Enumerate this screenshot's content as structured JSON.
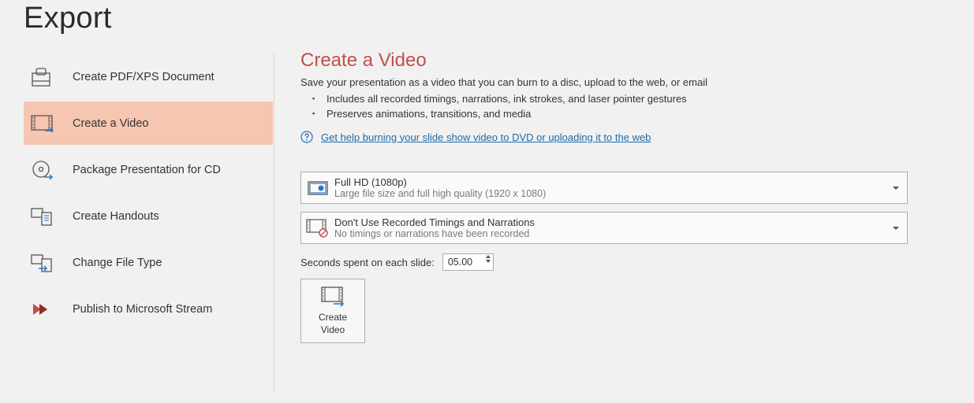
{
  "page_title": "Export",
  "sidebar": {
    "items": [
      {
        "label": "Create PDF/XPS Document"
      },
      {
        "label": "Create a Video"
      },
      {
        "label": "Package Presentation for CD"
      },
      {
        "label": "Create Handouts"
      },
      {
        "label": "Change File Type"
      },
      {
        "label": "Publish to Microsoft Stream"
      }
    ],
    "selected_index": 1
  },
  "panel": {
    "title": "Create a Video",
    "subtitle": "Save your presentation as a video that you can burn to a disc, upload to the web, or email",
    "bullet1": "Includes all recorded timings, narrations, ink strokes, and laser pointer gestures",
    "bullet2": "Preserves animations, transitions, and media",
    "help_link": "Get help burning your slide show video to DVD or uploading it to the web"
  },
  "quality": {
    "title": "Full HD (1080p)",
    "sub": "Large file size and full high quality (1920 x 1080)"
  },
  "timings": {
    "title": "Don't Use Recorded Timings and Narrations",
    "sub": "No timings or narrations have been recorded"
  },
  "seconds": {
    "label": "Seconds spent on each slide:",
    "value": "05.00"
  },
  "create_button": {
    "line1": "Create",
    "line2": "Video"
  }
}
